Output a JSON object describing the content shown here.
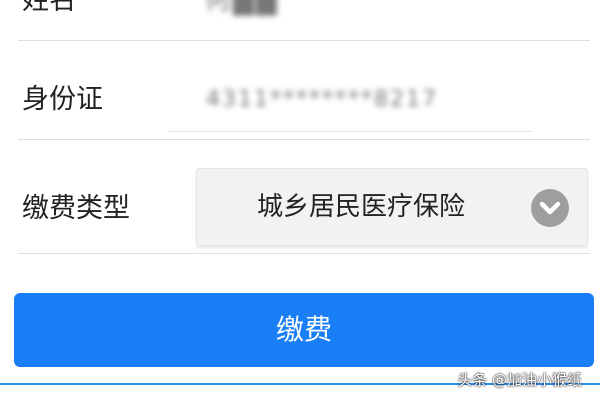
{
  "form": {
    "name": {
      "label": "姓名",
      "value": "何██"
    },
    "id_card": {
      "label": "身份证",
      "value": "4311********8217"
    },
    "payment_type": {
      "label": "缴费类型",
      "selected": "城乡居民医疗保险",
      "dropdown_icon": "chevron-down-circle-icon"
    },
    "submit_label": "缴费"
  },
  "colors": {
    "primary": "#1a7ff7",
    "divider": "#dedede",
    "select_bg": "#f2f2f2",
    "chevron_bg": "#9e9e9e"
  },
  "watermark": "头条 @加油小猴纸"
}
